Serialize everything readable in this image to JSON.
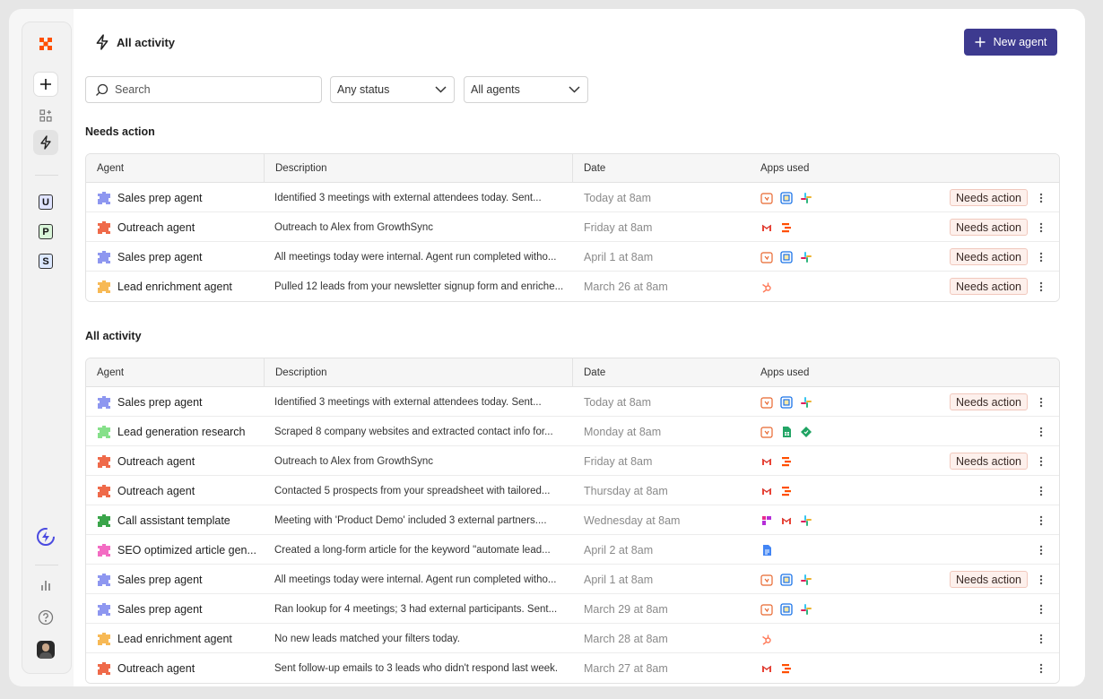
{
  "header": {
    "title": "All activity",
    "new_agent_label": "New agent"
  },
  "sidebar": {
    "letters": [
      {
        "letter": "U",
        "color": "#dfe3ff"
      },
      {
        "letter": "P",
        "color": "#d9f5d9"
      },
      {
        "letter": "S",
        "color": "#dce8ff"
      }
    ]
  },
  "filters": {
    "search_placeholder": "Search",
    "status_value": "Any status",
    "agents_value": "All agents"
  },
  "columns": {
    "agent": "Agent",
    "description": "Description",
    "date": "Date",
    "apps": "Apps used"
  },
  "badge_label": "Needs action",
  "agent_colors": {
    "sales": "#8e97f0",
    "outreach": "#ef6a4a",
    "lead_enrichment": "#f7b955",
    "lead_generation": "#86e08a",
    "call": "#3aa54a",
    "seo": "#f36cc3"
  },
  "needs_action": {
    "title": "Needs action",
    "rows": [
      {
        "agent": "Sales prep agent",
        "kind": "sales",
        "description": "Identified 3 meetings with external attendees today. Sent...",
        "date": "Today at 8am",
        "apps": [
          "calendar",
          "outlook",
          "slack"
        ],
        "needs_action": true
      },
      {
        "agent": "Outreach agent",
        "kind": "outreach",
        "description": "Outreach to Alex from GrowthSync",
        "date": "Friday at 8am",
        "apps": [
          "gmail",
          "zapier"
        ],
        "needs_action": true
      },
      {
        "agent": "Sales prep agent",
        "kind": "sales",
        "description": "All meetings today were internal. Agent run completed witho...",
        "date": "April 1 at 8am",
        "apps": [
          "calendar",
          "outlook",
          "slack"
        ],
        "needs_action": true
      },
      {
        "agent": "Lead enrichment agent",
        "kind": "lead_enrichment",
        "description": "Pulled 12 leads from your newsletter signup form and enriche...",
        "date": "March 26 at 8am",
        "apps": [
          "hubspot"
        ],
        "needs_action": true
      }
    ]
  },
  "all_activity": {
    "title": "All activity",
    "rows": [
      {
        "agent": "Sales prep agent",
        "kind": "sales",
        "description": "Identified 3 meetings with external attendees today. Sent...",
        "date": "Today at 8am",
        "apps": [
          "calendar",
          "outlook",
          "slack"
        ],
        "needs_action": true
      },
      {
        "agent": "Lead generation research",
        "kind": "lead_generation",
        "description": "Scraped 8 company websites and extracted contact info for...",
        "date": "Monday at 8am",
        "apps": [
          "calendar",
          "sheets",
          "diamond"
        ],
        "needs_action": false
      },
      {
        "agent": "Outreach agent",
        "kind": "outreach",
        "description": "Outreach to Alex from GrowthSync",
        "date": "Friday at 8am",
        "apps": [
          "gmail",
          "zapier"
        ],
        "needs_action": true
      },
      {
        "agent": "Outreach agent",
        "kind": "outreach",
        "description": "Contacted 5 prospects from your spreadsheet with tailored...",
        "date": "Thursday at 8am",
        "apps": [
          "gmail",
          "zapier"
        ],
        "needs_action": false
      },
      {
        "agent": "Call assistant template",
        "kind": "call",
        "description": "Meeting with 'Product Demo' included 3 external partners....",
        "date": "Wednesday at 8am",
        "apps": [
          "fireflies",
          "gmail",
          "slack"
        ],
        "needs_action": false
      },
      {
        "agent": "SEO optimized article gen...",
        "kind": "seo",
        "description": "Created a long-form article for the keyword \"automate lead...",
        "date": "April 2 at 8am",
        "apps": [
          "docs"
        ],
        "needs_action": false
      },
      {
        "agent": "Sales prep agent",
        "kind": "sales",
        "description": "All meetings today were internal. Agent run completed witho...",
        "date": "April 1 at 8am",
        "apps": [
          "calendar",
          "outlook",
          "slack"
        ],
        "needs_action": true
      },
      {
        "agent": "Sales prep agent",
        "kind": "sales",
        "description": "Ran lookup for 4 meetings; 3 had external participants. Sent...",
        "date": "March 29 at 8am",
        "apps": [
          "calendar",
          "outlook",
          "slack"
        ],
        "needs_action": false
      },
      {
        "agent": "Lead enrichment agent",
        "kind": "lead_enrichment",
        "description": "No new leads matched your filters today.",
        "date": "March 28 at 8am",
        "apps": [
          "hubspot"
        ],
        "needs_action": false
      },
      {
        "agent": "Outreach agent",
        "kind": "outreach",
        "description": "Sent follow-up emails to 3 leads who didn't respond last week.",
        "date": "March 27 at 8am",
        "apps": [
          "gmail",
          "zapier"
        ],
        "needs_action": false
      }
    ]
  }
}
